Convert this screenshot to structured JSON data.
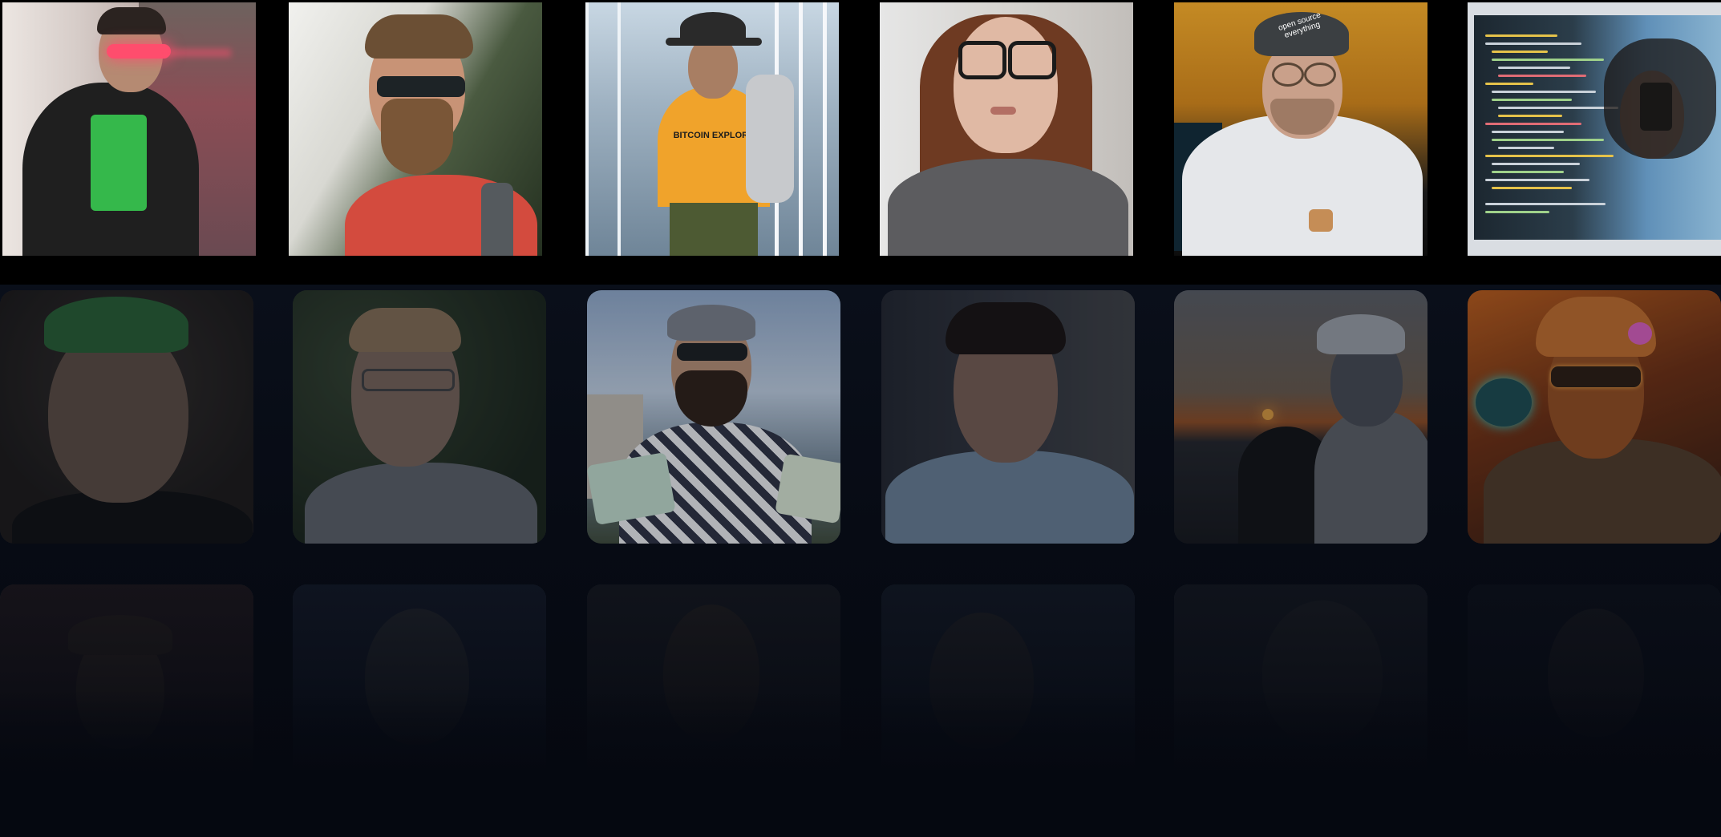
{
  "gallery": {
    "rows": [
      {
        "name": "top-row",
        "tiles": [
          {
            "name": "person-tile-neon-glasses",
            "shirt_text": "",
            "tone": "#6b5a4e",
            "bg": "#c9c1bd"
          },
          {
            "name": "person-tile-sunglasses-beard",
            "shirt_text": "",
            "tone": "#b0826c",
            "bg": "#cfd3c9"
          },
          {
            "name": "person-tile-hat-escalator",
            "shirt_text": "BITCOIN EXPLORE",
            "tone": "#8c6b56",
            "bg": "#9fb2c2"
          },
          {
            "name": "person-tile-glasses-woman",
            "shirt_text": "",
            "tone": "#e0b9a4",
            "bg": "#d8d6d3"
          },
          {
            "name": "person-tile-open-source-cap",
            "shirt_text": "",
            "cap_text": "open source everything",
            "tone": "#c9a08a",
            "bg": "#b8801e"
          },
          {
            "name": "person-tile-laptop-screen",
            "shirt_text": "",
            "tone": "#3b2b22",
            "bg": "#3c7fb0"
          }
        ]
      },
      {
        "name": "middle-row",
        "tiles": [
          {
            "name": "person-tile-green-cap",
            "tone": "#6d5a4d",
            "bg": "#2b2723"
          },
          {
            "name": "person-tile-blond-man",
            "tone": "#8d7567",
            "bg": "#2f3a2d"
          },
          {
            "name": "person-tile-cap-sunglasses",
            "tone": "#b08b72",
            "bg": "#8ba3c3"
          },
          {
            "name": "person-tile-dark-hair",
            "tone": "#8d6f60",
            "bg": "#2a2d35"
          },
          {
            "name": "person-tile-sunset-cap",
            "tone": "#55585f",
            "bg": "#5b5e67"
          },
          {
            "name": "person-tile-retro-pilot",
            "tone": "#8e4c22",
            "bg": "#6a2f14"
          }
        ]
      },
      {
        "name": "bottom-row",
        "tiles": [
          {
            "name": "person-tile-faded-1",
            "tone": "#3a2f2a",
            "bg": "#2a2024"
          },
          {
            "name": "person-tile-faded-2",
            "tone": "#2f333a",
            "bg": "#1a2233"
          },
          {
            "name": "person-tile-faded-3",
            "tone": "#2e2a29",
            "bg": "#1e2128"
          },
          {
            "name": "person-tile-faded-4",
            "tone": "#2a2b30",
            "bg": "#1a2230"
          },
          {
            "name": "person-tile-faded-5",
            "tone": "#25282d",
            "bg": "#1c2029"
          },
          {
            "name": "person-tile-faded-6",
            "tone": "#1f2026",
            "bg": "#101520"
          }
        ]
      }
    ]
  },
  "colors": {
    "background": "#050810",
    "neon_accent": "#ff4d6d",
    "green_print": "#39d353"
  }
}
